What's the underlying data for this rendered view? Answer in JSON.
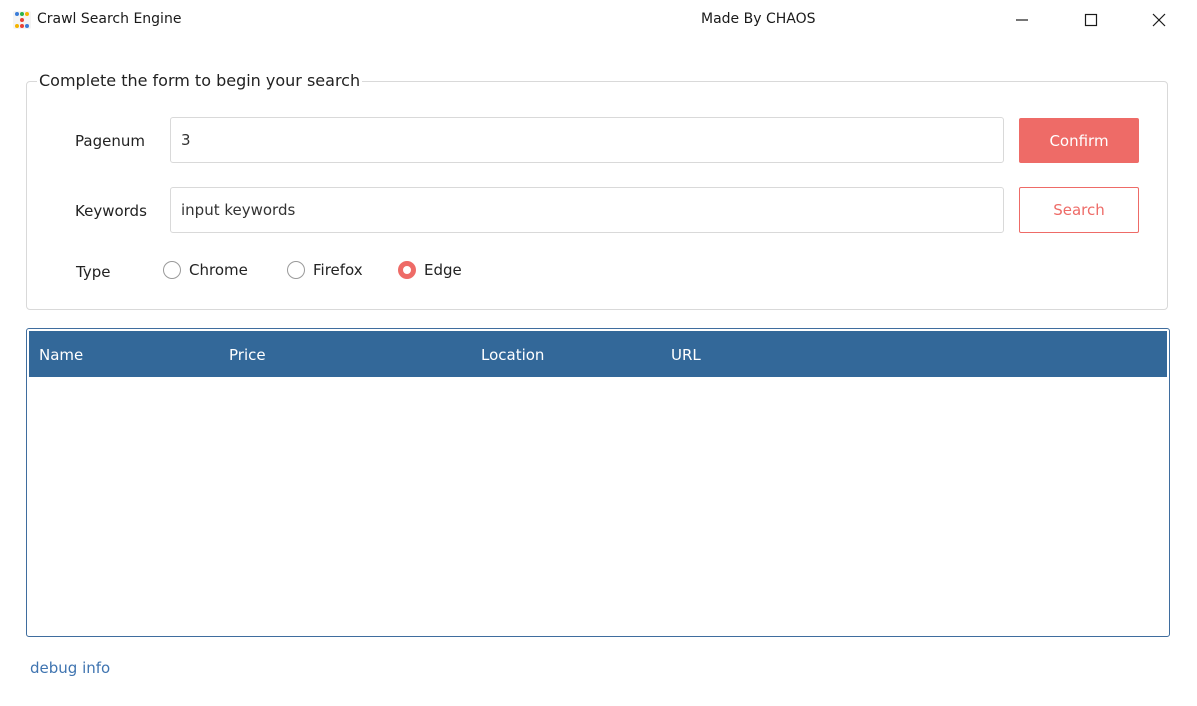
{
  "window": {
    "title": "Crawl Search Engine",
    "subtitle": "Made By CHAOS",
    "controls": [
      "minimize-icon",
      "maximize-icon",
      "close-icon"
    ]
  },
  "form": {
    "legend": "Complete the form to begin your search",
    "pagenum_label": "Pagenum",
    "pagenum_value": "3",
    "keywords_label": "Keywords",
    "keywords_placeholder": "input keywords",
    "confirm_label": "Confirm",
    "search_label": "Search",
    "type_label": "Type",
    "type_options": [
      {
        "label": "Chrome",
        "checked": false
      },
      {
        "label": "Firefox",
        "checked": false
      },
      {
        "label": "Edge",
        "checked": true
      }
    ]
  },
  "table": {
    "columns": [
      "Name",
      "Price",
      "Location",
      "URL"
    ],
    "rows": []
  },
  "footer": {
    "debug_text": "debug info"
  },
  "colors": {
    "accent": "#ee6b67",
    "table_header": "#336899",
    "link": "#3f74b0"
  }
}
